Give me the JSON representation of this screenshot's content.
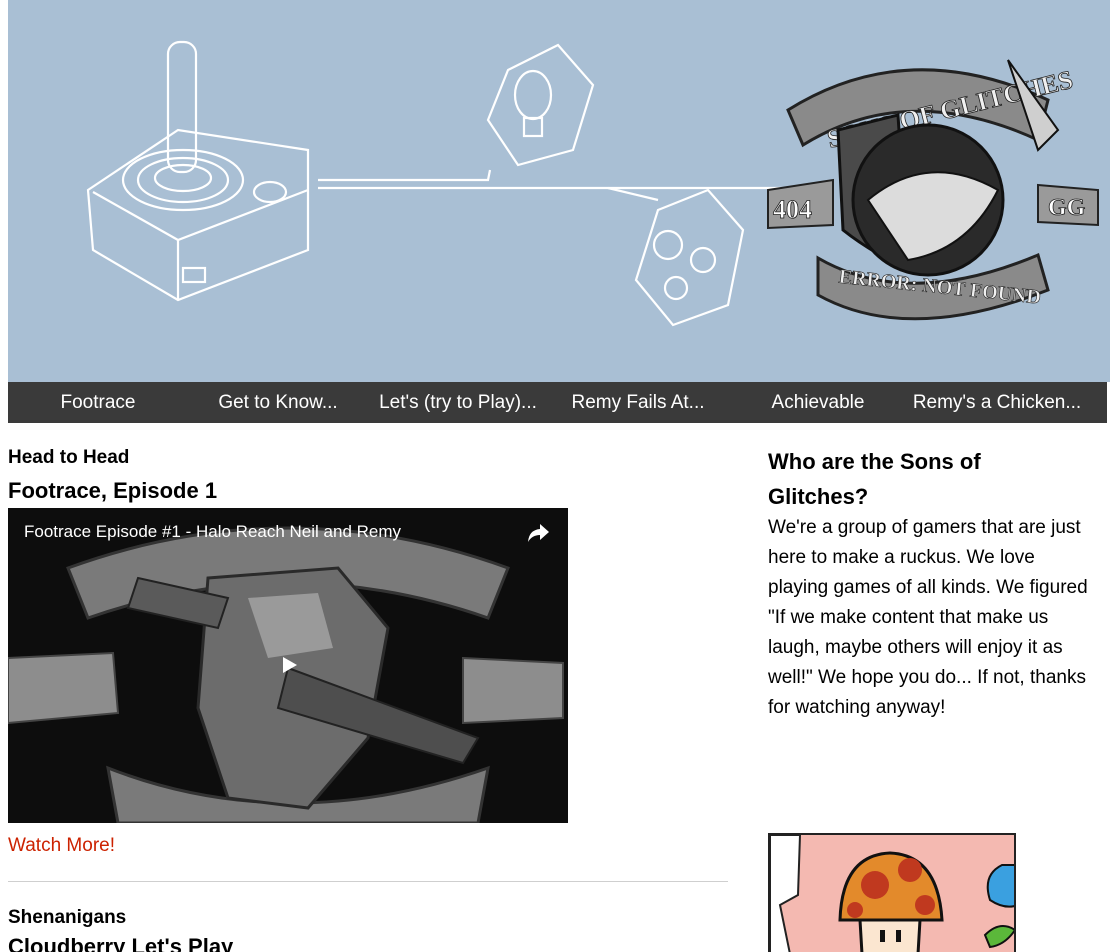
{
  "banner": {
    "logo_top_text": "SONS OF GLITCHES",
    "logo_left_text": "404",
    "logo_right_text": "GG",
    "logo_bottom_text": "ERROR: NOT FOUND"
  },
  "nav": {
    "items": [
      {
        "label": "Footrace"
      },
      {
        "label": "Get to Know..."
      },
      {
        "label": "Let's (try to Play)..."
      },
      {
        "label": "Remy Fails At..."
      },
      {
        "label": "Achievable"
      },
      {
        "label": "Remy's a Chicken..."
      }
    ]
  },
  "posts": [
    {
      "category": "Head to Head",
      "title": "Footrace, Episode 1",
      "video_title": "Footrace Episode #1 - Halo Reach Neil and Remy",
      "watch_more": "Watch More!"
    },
    {
      "category": "Shenanigans",
      "title": "Cloudberry Let's Play"
    }
  ],
  "sidebar": {
    "heading": "Who are the Sons of Glitches?",
    "text": "We're a group of gamers that are just here to make a ruckus. We love playing games of all kinds. We figured \"If we make content that make us laugh, maybe others will enjoy it as well!\" We hope you do... If not, thanks for watching anyway!"
  },
  "colors": {
    "banner_bg": "#a9bfd4",
    "nav_bg": "#3a3a3a",
    "link": "#cc2200"
  }
}
